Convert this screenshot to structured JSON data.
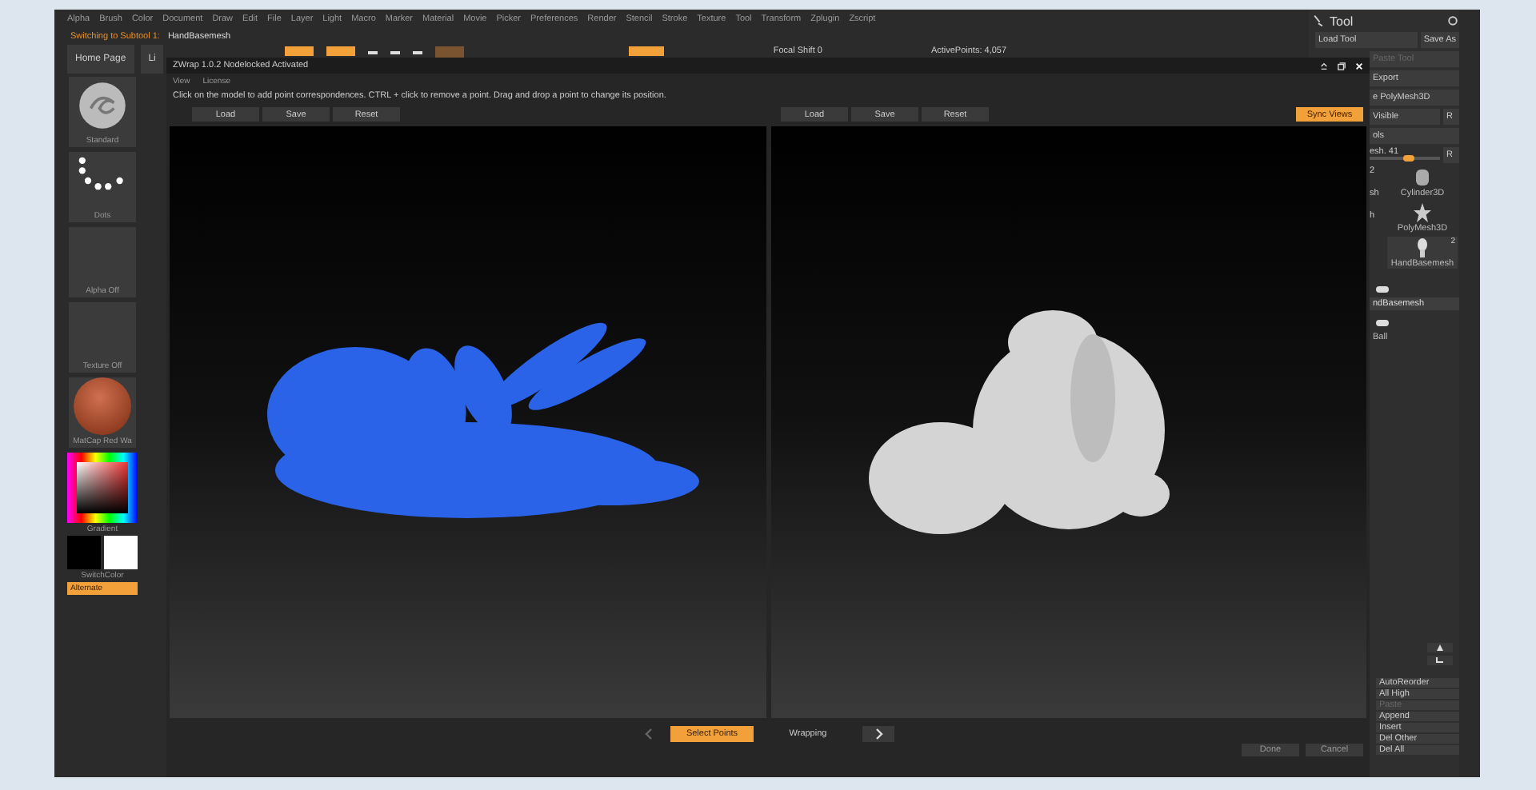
{
  "menu_bar": [
    "Alpha",
    "Brush",
    "Color",
    "Document",
    "Draw",
    "Edit",
    "File",
    "Layer",
    "Light",
    "Macro",
    "Marker",
    "Material",
    "Movie",
    "Picker",
    "Preferences",
    "Render",
    "Stencil",
    "Stroke",
    "Texture",
    "Tool",
    "Transform",
    "Zplugin",
    "Zscript"
  ],
  "subtool_status": {
    "label": "Switching to Subtool 1:",
    "value": "HandBasemesh"
  },
  "nav_buttons": [
    "Home Page",
    "Li"
  ],
  "toolbar": {
    "focal_shift": "Focal Shift 0",
    "active_points": "ActivePoints: 4,057"
  },
  "left_shelf": [
    {
      "kind": "brush",
      "label": "Standard"
    },
    {
      "kind": "stroke",
      "label": "Dots"
    },
    {
      "kind": "empty",
      "label": "Alpha Off"
    },
    {
      "kind": "empty",
      "label": "Texture Off"
    },
    {
      "kind": "material",
      "label": "MatCap Red Wa"
    }
  ],
  "color_picker": {
    "label": "Gradient"
  },
  "switch_color": {
    "label": "SwitchColor"
  },
  "alternate": {
    "label": "Alternate",
    "on": true
  },
  "tool_panel": {
    "title": "Tool",
    "rows": [
      {
        "kind": "pair",
        "left": "Load Tool",
        "right": "Save As",
        "disabled": false
      },
      {
        "kind": "single",
        "label": "Paste Tool",
        "disabled": true
      },
      {
        "kind": "single",
        "label": "Export",
        "disabled": false
      },
      {
        "kind": "single",
        "label": "e PolyMesh3D",
        "disabled": false
      },
      {
        "kind": "pair",
        "left": "Visible",
        "right": "R",
        "disabled": false
      },
      {
        "kind": "single",
        "label": "ols",
        "disabled": false
      }
    ],
    "slider": {
      "label": "esh. 41",
      "level": 0.55,
      "button": "R"
    },
    "partial_column": [
      "2",
      "sh",
      "h"
    ],
    "thumbnails": [
      {
        "kind": "cylinder",
        "label": "Cylinder3D"
      },
      {
        "kind": "star",
        "label": "PolyMesh3D"
      },
      {
        "kind": "hand",
        "label": "HandBasemesh",
        "badge": "2"
      }
    ],
    "subtools": [
      {
        "label": "ndBasemesh",
        "selected": true,
        "visible": true
      },
      {
        "label": "Ball",
        "selected": false,
        "visible": true
      }
    ],
    "actions": [
      {
        "label": "AutoReorder",
        "disabled": false
      },
      {
        "label": "All High",
        "disabled": false
      },
      {
        "label": "Paste",
        "disabled": true
      },
      {
        "label": "Append",
        "disabled": false
      },
      {
        "label": "Insert",
        "disabled": false
      },
      {
        "label": "Del Other",
        "disabled": false
      },
      {
        "label": "Del All",
        "disabled": false
      }
    ]
  },
  "zwrap": {
    "title": "ZWrap 1.0.2  Nodelocked Activated",
    "menu": [
      "View",
      "License"
    ],
    "instruction": "Click on the model to add point correspondences. CTRL + click to remove a point. Drag and drop a point to change its position.",
    "left_buttons": [
      "Load",
      "Save",
      "Reset"
    ],
    "right_buttons": [
      "Load",
      "Save",
      "Reset"
    ],
    "sync_views": {
      "label": "Sync Views",
      "on": true
    },
    "steps": [
      {
        "label": "Select Points",
        "selected": true
      },
      {
        "label": "Wrapping",
        "selected": false
      }
    ],
    "footer_buttons": [
      "Done",
      "Cancel"
    ]
  }
}
